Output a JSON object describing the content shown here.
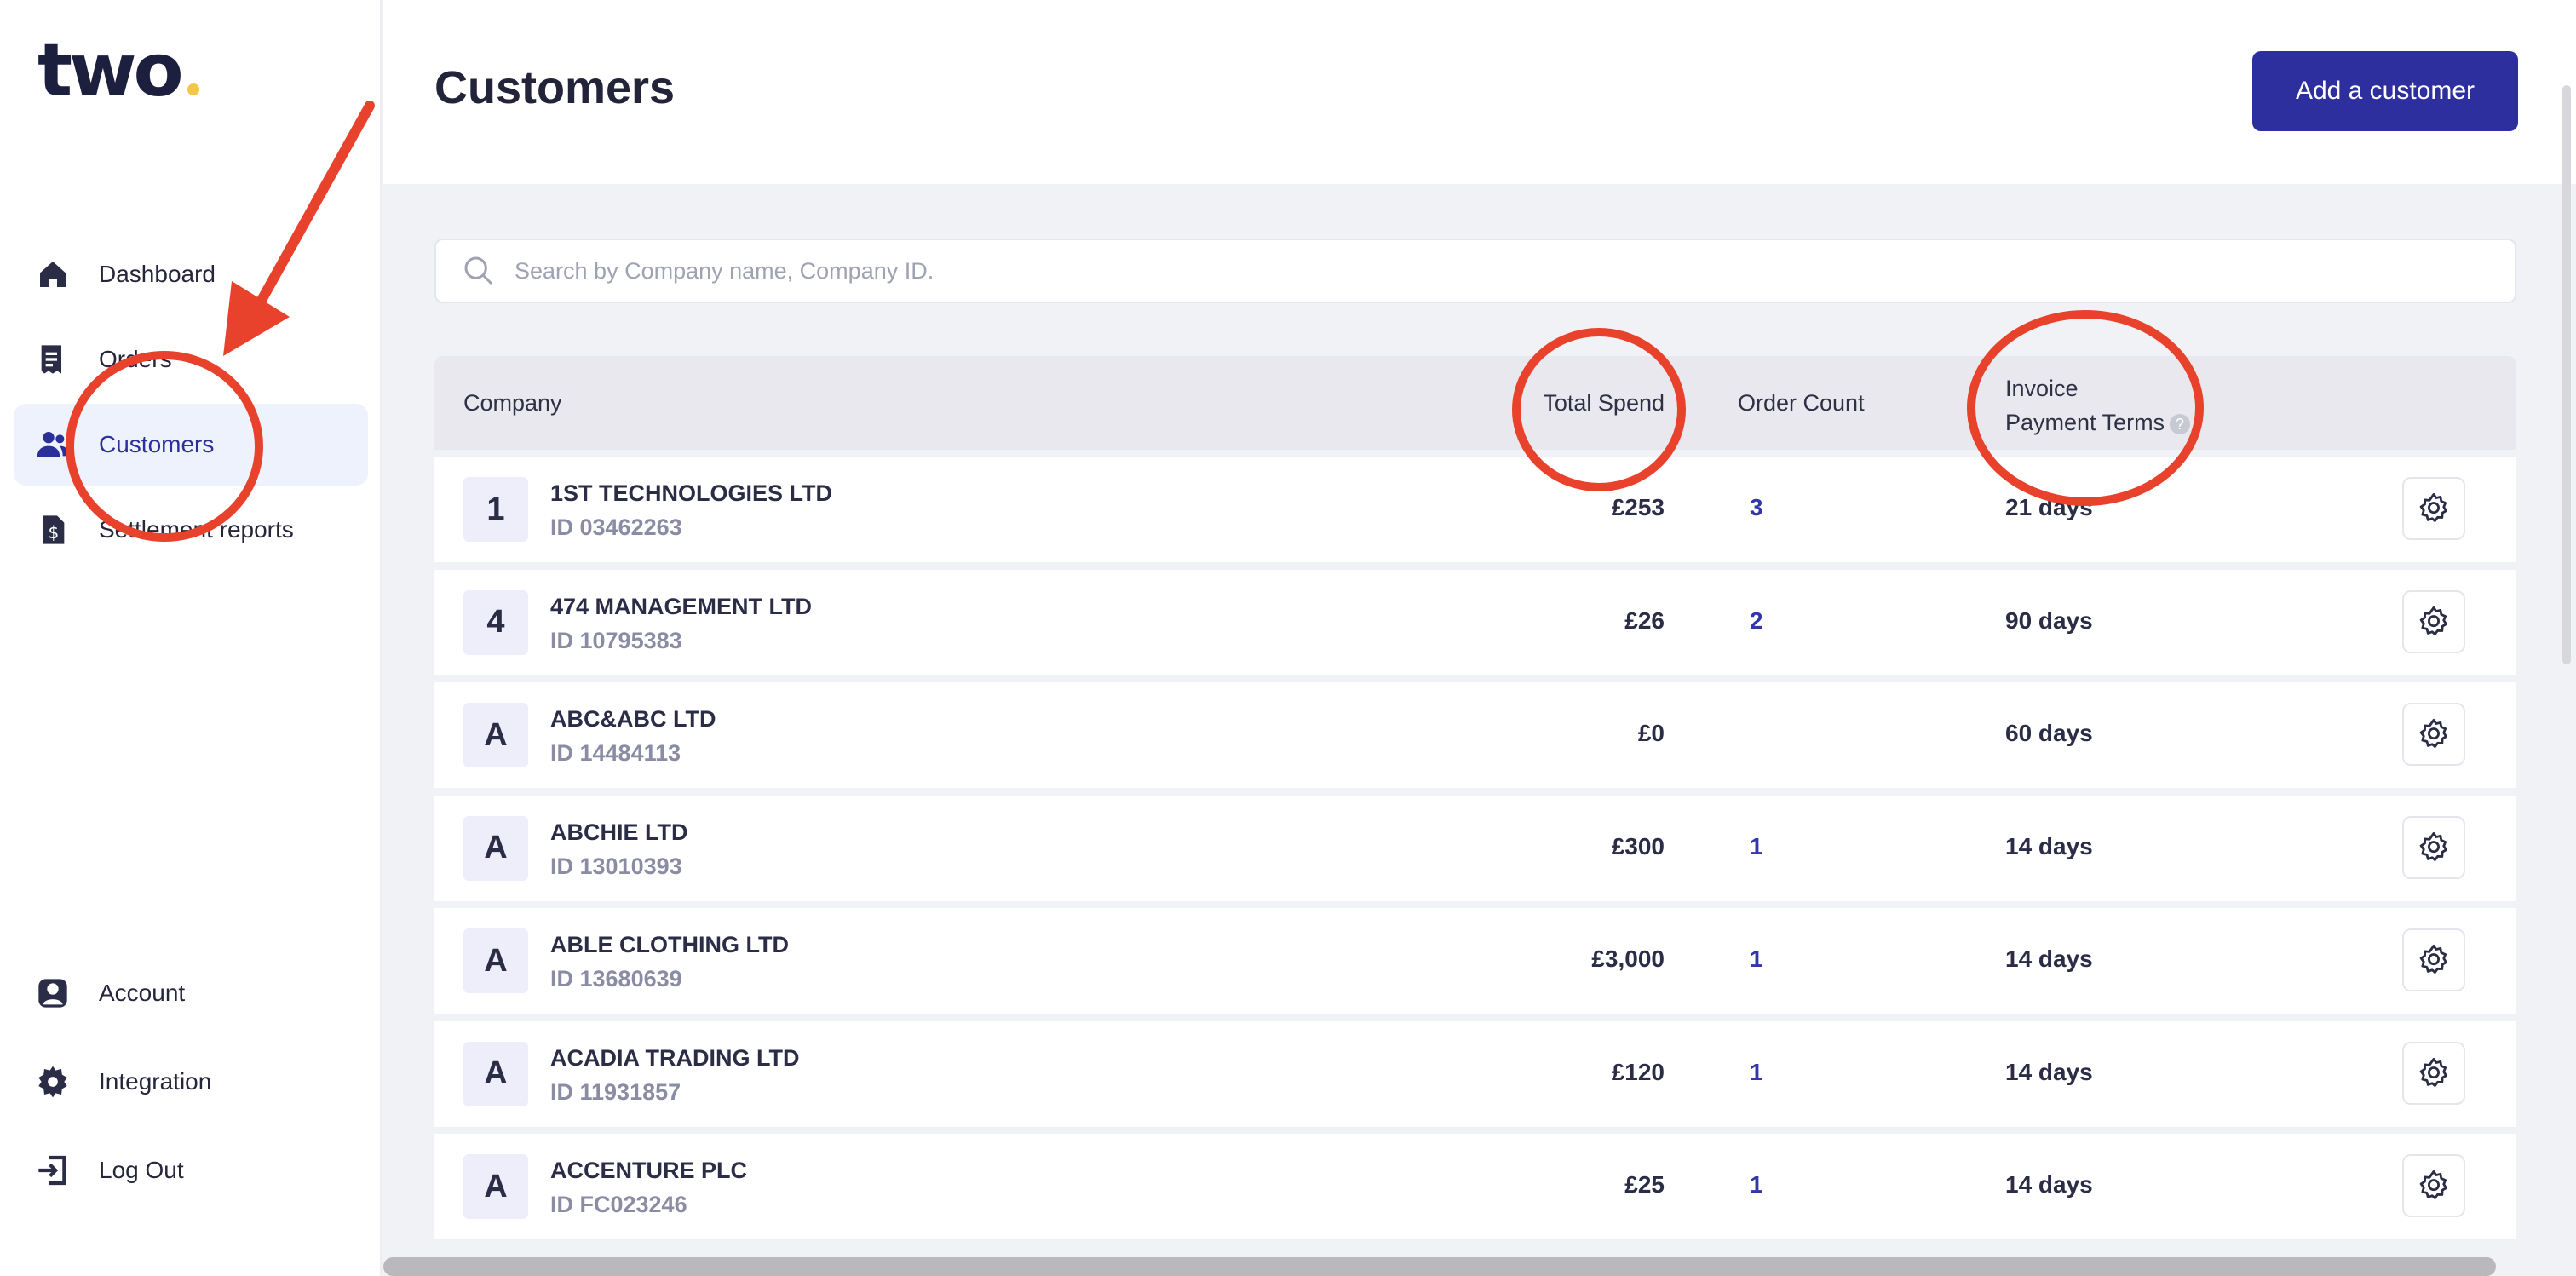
{
  "app": {
    "logo_text": "two"
  },
  "sidebar": {
    "items": [
      {
        "label": "Dashboard",
        "icon": "home-icon"
      },
      {
        "label": "Orders",
        "icon": "receipt-icon"
      },
      {
        "label": "Customers",
        "icon": "users-icon",
        "active": true
      },
      {
        "label": "Settlement reports",
        "icon": "document-dollar-icon"
      }
    ],
    "bottom_items": [
      {
        "label": "Account",
        "icon": "account-icon"
      },
      {
        "label": "Integration",
        "icon": "gear-icon"
      },
      {
        "label": "Log Out",
        "icon": "logout-icon"
      }
    ]
  },
  "header": {
    "title": "Customers",
    "add_button": "Add a customer"
  },
  "search": {
    "placeholder": "Search by Company name, Company ID."
  },
  "table": {
    "headers": {
      "company": "Company",
      "total_spend": "Total Spend",
      "order_count": "Order Count",
      "terms_line1": "Invoice",
      "terms_line2": "Payment Terms",
      "help": "?"
    },
    "rows": [
      {
        "initial": "1",
        "name": "1ST TECHNOLOGIES LTD",
        "id": "ID 03462263",
        "spend": "£253",
        "orders": "3",
        "terms": "21 days"
      },
      {
        "initial": "4",
        "name": "474 MANAGEMENT LTD",
        "id": "ID 10795383",
        "spend": "£26",
        "orders": "2",
        "terms": "90 days"
      },
      {
        "initial": "A",
        "name": "ABC&ABC LTD",
        "id": "ID 14484113",
        "spend": "£0",
        "orders": "",
        "terms": "60 days"
      },
      {
        "initial": "A",
        "name": "ABCHIE LTD",
        "id": "ID 13010393",
        "spend": "£300",
        "orders": "1",
        "terms": "14 days"
      },
      {
        "initial": "A",
        "name": "ABLE CLOTHING LTD",
        "id": "ID 13680639",
        "spend": "£3,000",
        "orders": "1",
        "terms": "14 days"
      },
      {
        "initial": "A",
        "name": "ACADIA TRADING LTD",
        "id": "ID 11931857",
        "spend": "£120",
        "orders": "1",
        "terms": "14 days"
      },
      {
        "initial": "A",
        "name": "ACCENTURE PLC",
        "id": "ID FC023246",
        "spend": "£25",
        "orders": "1",
        "terms": "14 days"
      }
    ]
  },
  "colors": {
    "accent": "#2d2f9e",
    "annotation": "#e8412c",
    "logo_dot": "#f3c64a"
  }
}
